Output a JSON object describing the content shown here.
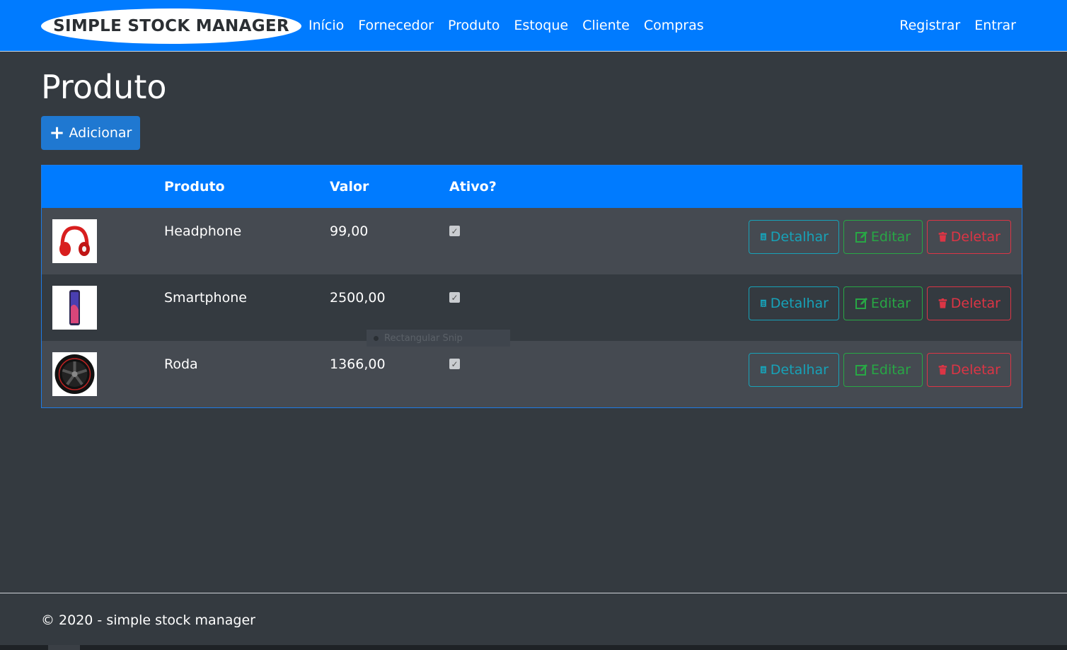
{
  "navbar": {
    "brand": "SIMPLE STOCK MANAGER",
    "links": [
      "Início",
      "Fornecedor",
      "Produto",
      "Estoque",
      "Cliente",
      "Compras"
    ],
    "right_links": [
      "Registrar",
      "Entrar"
    ]
  },
  "page": {
    "title": "Produto",
    "add_button": "Adicionar"
  },
  "table": {
    "headers": [
      "",
      "Produto",
      "Valor",
      "Ativo?"
    ],
    "rows": [
      {
        "image_icon": "headphone-icon",
        "produto": "Headphone",
        "valor": "99,00",
        "ativo": true
      },
      {
        "image_icon": "smartphone-icon",
        "produto": "Smartphone",
        "valor": "2500,00",
        "ativo": true
      },
      {
        "image_icon": "wheel-icon",
        "produto": "Roda",
        "valor": "1366,00",
        "ativo": true
      }
    ],
    "actions": {
      "details": "Detalhar",
      "edit": "Editar",
      "delete": "Deletar"
    }
  },
  "overlay": {
    "ghost_label": "Rectangular Snip"
  },
  "footer": {
    "text": "© 2020 - simple stock manager"
  },
  "colors": {
    "primary": "#007bff",
    "background": "#343a40",
    "info": "#17a2b8",
    "success": "#28a745",
    "danger": "#dc3545"
  }
}
